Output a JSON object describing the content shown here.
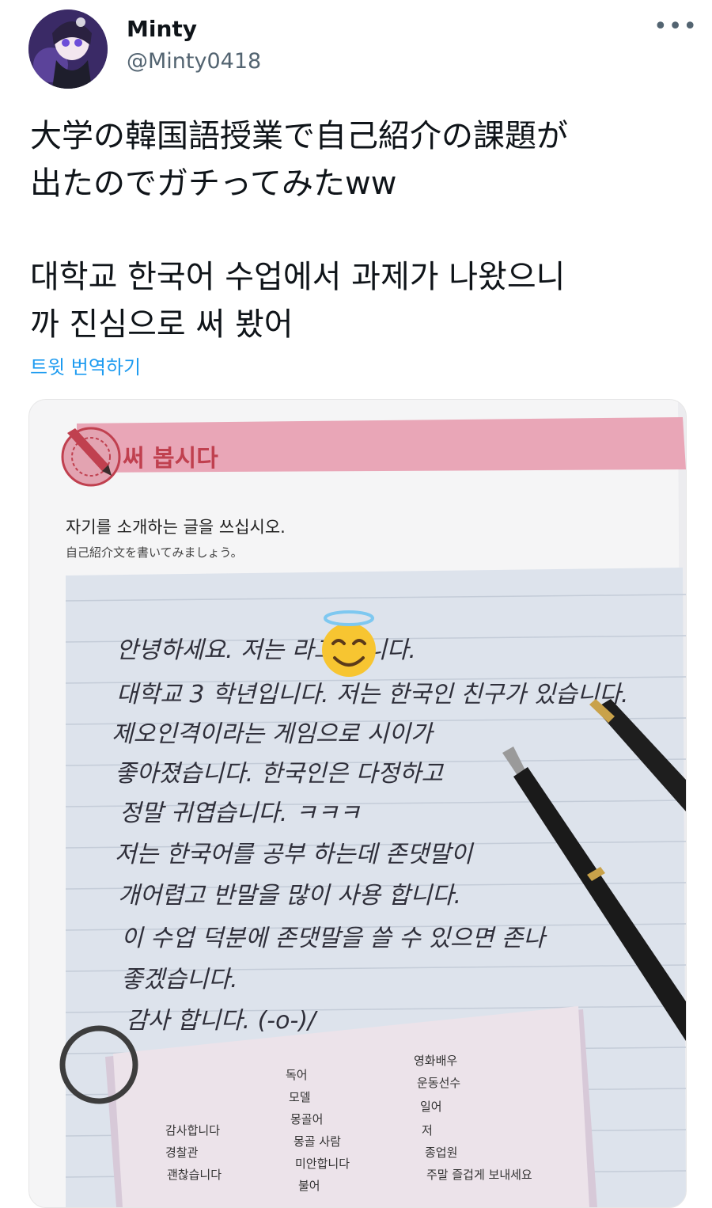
{
  "author": {
    "display_name": "Minty",
    "handle": "@Minty0418",
    "avatar": "anime-character-avatar"
  },
  "more_icon": "•••",
  "tweet": {
    "text_jp": "大学の韓国語授業で自己紹介の課題が\n出たのでガチってみたww",
    "text_ko": "대학교 한국어 수업에서 과제가 나왔으니\n까 진심으로 써 봤어",
    "translate_label": "트윗 번역하기"
  },
  "photo": {
    "section_title": "써 봅시다",
    "instruction_ko": "자기를 소개하는 글을 쓰십시오.",
    "instruction_jp": "自己紹介文を書いてみましょう。",
    "handwriting": [
      "안녕하세요. 저는          라고 합니다.",
      "대학교 3 학년입니다. 저는 한국인 친구가 있습니다.",
      "제오인격이라는 게임으로 시이가",
      "좋아졌습니다. 한국인은 다정하고",
      "정말 귀엽습니다. ㅋㅋㅋ",
      "저는 한국어를 공부 하는데 존댓말이",
      "개어렵고 반말을 많이 사용 합니다.",
      "이 수업 덕분에 존댓말을 쓸 수 있으면 존나",
      "좋겠습니다.",
      "감사 합니다. (-o-)/"
    ],
    "card_col1": [
      "감사합니다",
      "경찰관",
      "괜찮습니다"
    ],
    "card_col2": [
      "독어",
      "모델",
      "몽골어",
      "몽골 사람",
      "미안합니다",
      "불어"
    ],
    "card_col3": [
      "영화배우",
      "운동선수",
      "일어",
      "저",
      "종업원",
      "주말 즐겁게 보내세요"
    ],
    "emoji": "smiling-face-with-halo"
  },
  "colors": {
    "handle": "#536471",
    "link": "#1d9bf0",
    "banner_pink": "#e9a6b7",
    "banner_text": "#c0404f",
    "paper_blue": "#dde3ec"
  }
}
